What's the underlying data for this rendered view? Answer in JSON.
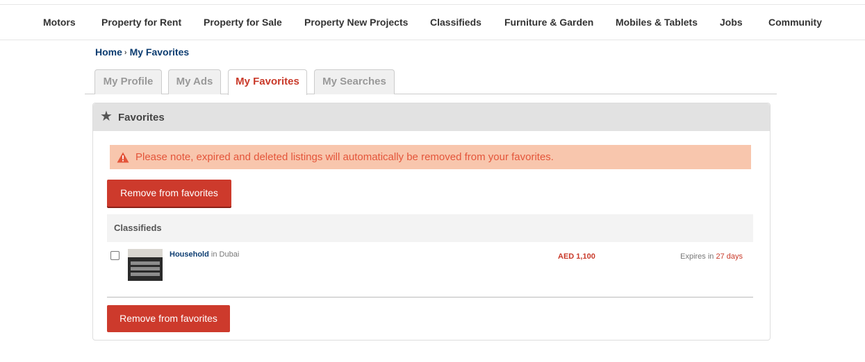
{
  "nav": {
    "items": [
      "Motors",
      "Property for Rent",
      "Property for Sale",
      "Property New Projects",
      "Classifieds",
      "Furniture & Garden",
      "Mobiles & Tablets",
      "Jobs",
      "Community"
    ]
  },
  "breadcrumb": {
    "home": "Home",
    "separator": "›",
    "current": "My Favorites"
  },
  "tabs": [
    "My Profile",
    "My Ads",
    "My Favorites",
    "My Searches"
  ],
  "panel": {
    "star_icon": "★",
    "title": "Favorites",
    "notice": "Please note, expired and deleted listings will automatically be removed from your favorites.",
    "remove_label": "Remove from favorites",
    "section_title": "Classifieds",
    "listing": {
      "name": "Household",
      "in_label": "in",
      "location": "Dubai",
      "price": "AED 1,100",
      "expires_label": "Expires in",
      "expires_days": "27 days"
    }
  },
  "colors": {
    "accent": "#cd3a2c",
    "link": "#0d3d71",
    "notice_bg": "#f8c6ad"
  }
}
